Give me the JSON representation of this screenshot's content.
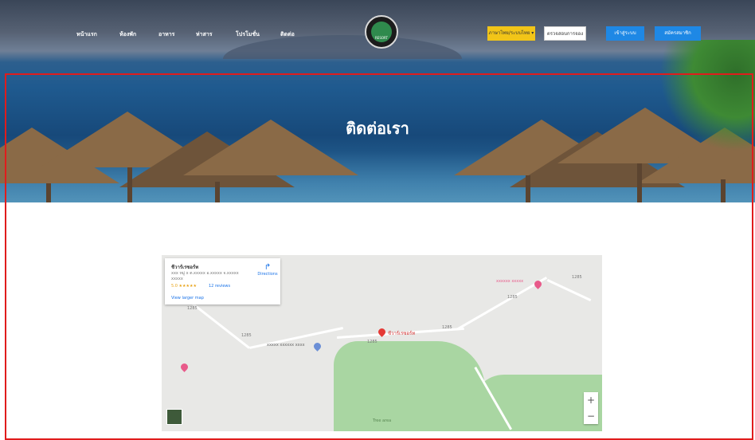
{
  "nav": {
    "links": [
      "หน้าแรก",
      "ห้องพัก",
      "อาหาร",
      "ห่าสาร",
      "โปรโมชั่น",
      "ติดต่อ"
    ]
  },
  "logo": {
    "text": "RESORT"
  },
  "buttons": {
    "lang": "ภาษาไทย/ระบบไทย ▾",
    "check": "ตรวจสอบการจอง",
    "login": "เข้าสู่ระบบ",
    "register": "สมัครสมาชิก"
  },
  "page_title": "ติดต่อเรา",
  "map": {
    "card_title": "ชีวาร์เรซอร์ท",
    "card_address": "xxx หมู่ x ต.xxxxx อ.xxxxx จ.xxxxx xxxxx",
    "card_rating": "5.0 ★★★★★",
    "card_reviews": "12 reviews",
    "card_larger": "View larger map",
    "card_directions": "Directions",
    "place_red": "ชีวาร์เรซอร์ท",
    "place_blue": "xxxxx xxxxxx xxxx",
    "place_pink": "xxxxxx xxxxx",
    "road_labels": [
      "1285",
      "1285",
      "1285",
      "1285",
      "1285",
      "1285"
    ],
    "tree_label": "Tree area",
    "zoom_in": "+",
    "zoom_out": "−"
  },
  "colors": {
    "yellow_button": "#f2c518",
    "blue_button": "#1e88e5",
    "highlight_border": "#e01c1c"
  }
}
